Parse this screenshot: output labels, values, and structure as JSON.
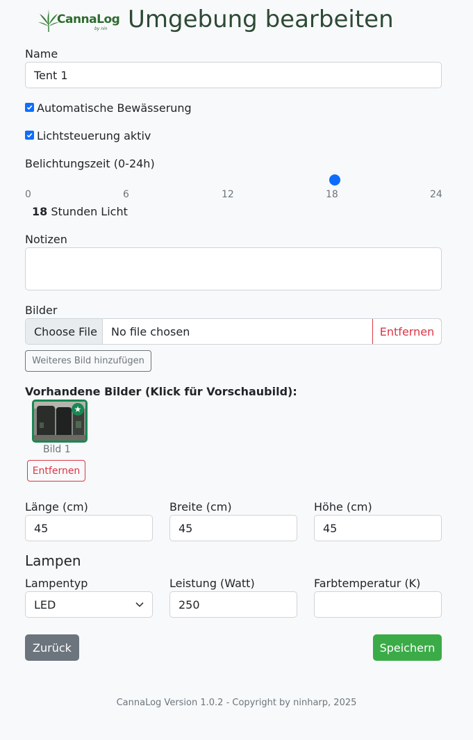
{
  "header": {
    "logo_text": "CannaLog",
    "logo_sub": "by nin",
    "title": "Umgebung bearbeiten"
  },
  "form": {
    "name_label": "Name",
    "name_value": "Tent 1",
    "auto_watering_label": "Automatische Bewässerung",
    "auto_watering_checked": true,
    "light_control_label": "Lichtsteuerung aktiv",
    "light_control_checked": true,
    "exposure_label": "Belichtungszeit (0-24h)",
    "exposure_ticks": [
      "0",
      "6",
      "12",
      "18",
      "24"
    ],
    "exposure_value": "18",
    "exposure_suffix": "Stunden Licht",
    "notes_label": "Notizen",
    "notes_value": "",
    "images_label": "Bilder",
    "choose_file": "Choose File",
    "no_file": "No file chosen",
    "remove_file": "Entfernen",
    "add_image": "Weiteres Bild hinzufügen",
    "existing_images_heading": "Vorhandene Bilder (Klick für Vorschaubild):",
    "existing_images": [
      {
        "caption": "Bild 1",
        "remove": "Entfernen",
        "is_preview": true
      }
    ],
    "length_label": "Länge (cm)",
    "length_value": "45",
    "width_label": "Breite (cm)",
    "width_value": "45",
    "height_label": "Höhe (cm)",
    "height_value": "45",
    "lamps_heading": "Lampen",
    "lamp_type_label": "Lampentyp",
    "lamp_type_value": "LED",
    "power_label": "Leistung (Watt)",
    "power_value": "250",
    "color_temp_label": "Farbtemperatur (K)",
    "color_temp_value": ""
  },
  "buttons": {
    "back": "Zurück",
    "save": "Speichern"
  },
  "footer": "CannaLog Version 1.0.2 - Copyright by ninharp, 2025",
  "colors": {
    "primary": "#0d6efd",
    "success": "#3bab47",
    "danger": "#dc3545",
    "secondary": "#6c757d"
  }
}
